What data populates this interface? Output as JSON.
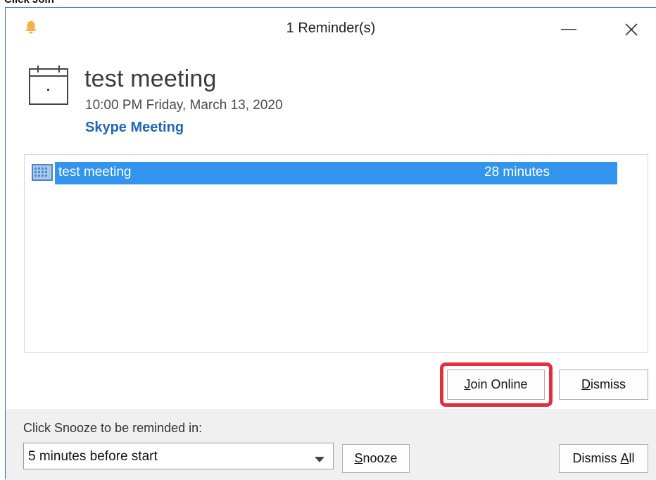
{
  "caption_fragment": "Click Join",
  "window": {
    "title": "1 Reminder(s)"
  },
  "reminder": {
    "subject": "test meeting",
    "datetime": "10:00 PM Friday, March 13, 2020",
    "location": "Skype Meeting"
  },
  "list": {
    "rows": [
      {
        "subject": "test meeting",
        "due": "28 minutes",
        "selected": true
      }
    ]
  },
  "buttons": {
    "join_online": {
      "access_key": "J",
      "rest": "oin Online"
    },
    "dismiss": {
      "access_key": "D",
      "rest": "ismiss"
    },
    "snooze": {
      "access_key": "S",
      "rest": "nooze"
    },
    "dismiss_all": {
      "prefix": "Dismiss ",
      "access_key": "A",
      "rest": "ll"
    }
  },
  "snooze": {
    "label": "Click Snooze to be reminded in:",
    "selected_option": "5 minutes before start"
  },
  "colors": {
    "selection": "#3394ee",
    "link": "#2266b6",
    "highlight": "#e0303e",
    "bell": "#f5b04a"
  },
  "icons": [
    "bell-icon",
    "minimize-icon",
    "close-icon",
    "calendar-icon",
    "appointment-icon",
    "dropdown-arrow-icon"
  ]
}
